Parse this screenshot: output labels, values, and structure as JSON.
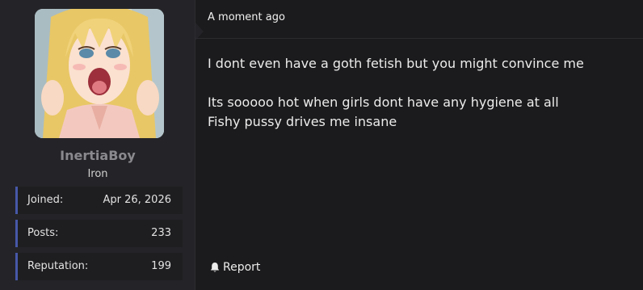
{
  "user": {
    "username": "InertiaBoy",
    "rank": "Iron",
    "avatar_icon": "anime-avatar-image",
    "stats": [
      {
        "label": "Joined:",
        "value": "Apr 26, 2026"
      },
      {
        "label": "Posts:",
        "value": "233"
      },
      {
        "label": "Reputation:",
        "value": "199"
      }
    ]
  },
  "post": {
    "timestamp": "A moment ago",
    "lines": [
      "I dont even have a goth fetish but you might convince me",
      "Its sooooo hot when girls dont have any hygiene at all",
      "Fishy pussy drives me insane"
    ],
    "report_label": "Report",
    "report_icon": "bell-icon"
  },
  "colors": {
    "panel_bg": "#242428",
    "page_bg": "#1b1b1d",
    "stat_accent": "#4757a8",
    "username": "#8a8a8e"
  }
}
